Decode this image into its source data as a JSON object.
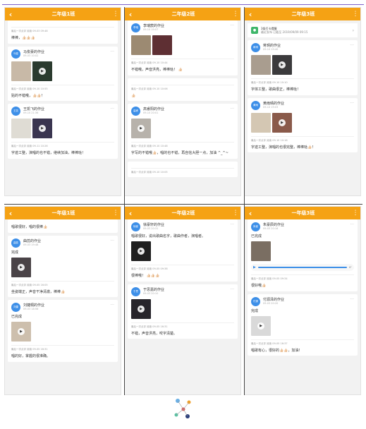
{
  "colors": {
    "header": "#f5a214",
    "avatar": "#3d8fe8",
    "notice": "#3fb66a",
    "divider": "#444444"
  },
  "panels": [
    {
      "header": {
        "title": "二年级1班"
      },
      "cards": [
        {
          "kind": "partial",
          "meta": "最后一次点评 阅读 09-03 09:48",
          "comment": "棒棒，👍🏻👍🏻👍🏻"
        },
        {
          "kind": "post",
          "avatar": "马俊",
          "name": "马俊豪的作业",
          "time": "09-03 10:02",
          "thumbs": [
            "#c8b9a7",
            "#2b3b2f"
          ],
          "play_index": 1,
          "text": "",
          "meta": "最后一次点评 阅读 09-10 10:55",
          "comment": "贴的不错哦，👍🏻👍🏻！"
        },
        {
          "kind": "post",
          "avatar": "王凯",
          "name": "王凯飞的作业",
          "time": "09-10 21:36",
          "thumbs": [
            "#dfdcd4",
            "#3a3550"
          ],
          "play_index": 1,
          "text": "",
          "meta": "最后一次点评 阅读 09-11 10:26",
          "comment": "字迹工整，演唱的也不错，继续加油，棒棒哒！"
        }
      ]
    },
    {
      "header": {
        "title": "二年级2班"
      },
      "cards": [
        {
          "kind": "post",
          "avatar": "李瑞",
          "name": "李瑞宸的作业",
          "time": "09-10 19:07",
          "thumbs": [
            "#9c8a72",
            "#5e2f33"
          ],
          "play_index": -1,
          "text": "",
          "meta": "最后一次点评 阅读 09-10 10:44",
          "comment": "不错哦，声音洪亮，棒棒哒！ 👍🏻"
        },
        {
          "kind": "partial",
          "meta": "最后一次点评 阅读 09-10 10:06",
          "comment": "👍🏻"
        },
        {
          "kind": "post",
          "avatar": "高睿",
          "name": "高睿阳的作业",
          "time": "09-10 20:01",
          "thumbs": [
            "#b7b2ab"
          ],
          "play_index": 0,
          "text": "",
          "meta": "最后一次点评 阅读 09-10 10:48",
          "comment": "字写的不错哦👍🏻，唱的也不错，再自信大胆一点，加油 ^_^~"
        },
        {
          "kind": "partial",
          "meta": "最后一次点评 阅读 09-10 10:05",
          "comment": ""
        }
      ]
    },
    {
      "header": {
        "title": "二年级3班"
      },
      "notice": {
        "title": "3条打卡提醒",
        "sub": "最近发布 已截至 2019/09/09 09:15"
      },
      "cards": [
        {
          "kind": "post",
          "avatar": "蒋玥",
          "name": "蒋玥的作业",
          "time": "09-10 19:40",
          "thumbs": [
            "#a99d8f",
            "#3b3a3c"
          ],
          "play_index": 1,
          "text": "",
          "meta": "最后一次点评 阅读 09-10 10:10",
          "comment": "字体工整，歌曲很正，棒棒哒！"
        },
        {
          "kind": "post",
          "avatar": "黄雨",
          "name": "黄雨晴的作业",
          "time": "09-10 19:03",
          "thumbs": [
            "#d4c7b3",
            "#8a5a4a"
          ],
          "play_index": 1,
          "text": "",
          "meta": "最后一次点评 阅读 09-10 10:18",
          "comment": "字迹工整，演唱的也很完整，棒棒哒👍🏻！"
        }
      ]
    },
    {
      "header": {
        "title": "一年级1班"
      },
      "cards": [
        {
          "kind": "partial",
          "meta": "",
          "comment": "唱歌很好，唱的很棒👍🏻"
        },
        {
          "kind": "post",
          "avatar": "曲蕊",
          "name": "曲蕊的作业",
          "time": "09-03 19:48",
          "thumbs": [
            "#4a4347"
          ],
          "play_index": 0,
          "text": "完成",
          "meta": "最后一次点评 阅读 09-05 16:05",
          "comment": "坐姿端正，声音干净清澈，棒棒👍🏻"
        },
        {
          "kind": "post",
          "avatar": "刘婕",
          "name": "刘婕桐的作业",
          "time": "09-03 18:56",
          "thumbs": [
            "#cdbfad"
          ],
          "play_index": 0,
          "text": "已完成",
          "meta": "最后一次点评 阅读 09-05 16:31",
          "comment": "唱的好，掌握的很准确。"
        }
      ]
    },
    {
      "header": {
        "title": "一年级2班"
      },
      "cards": [
        {
          "kind": "post",
          "avatar": "徐豪",
          "name": "徐豪轩的作业",
          "time": "09-03 20:31",
          "thumbs": [
            "#1f1f1f"
          ],
          "play_index": 0,
          "text": "唱歌很好，说出歌曲名字，歌曲作者，演唱者。",
          "meta": "最后一次点评 阅读 09-05 09:38",
          "comment": "很棒哦！ 👍🏻👍🏻👍🏻"
        },
        {
          "kind": "post",
          "avatar": "于思",
          "name": "于思嘉的作业",
          "time": "09-03 20:10",
          "thumbs": [
            "#27252b"
          ],
          "play_index": 0,
          "text": "",
          "meta": "最后一次点评 阅读 09-05 16:31",
          "comment": "不错，声音洪亮，咬字清楚。"
        }
      ]
    },
    {
      "header": {
        "title": "一年级3班"
      },
      "cards": [
        {
          "kind": "post",
          "avatar": "朱豪",
          "name": "朱豪辰的作业",
          "time": "09-03 20:16",
          "thumbs": [
            "#7a6e62"
          ],
          "play_index": -1,
          "text": "已完成",
          "audio": "8\"",
          "meta": "最后一次点评 阅读 09-05 09:34",
          "comment": "很好哦👍🏻"
        },
        {
          "kind": "post",
          "avatar": "付源",
          "name": "付源泽的作业",
          "time": "09-03 20:20",
          "thumbs": [
            "#d9d9d9"
          ],
          "play_index": 0,
          "text": "完成",
          "meta": "最后一次点评 阅读 09-05 16:37",
          "comment": "唱歌有心，很好的👍🏻👍🏻，加油！"
        }
      ]
    }
  ]
}
